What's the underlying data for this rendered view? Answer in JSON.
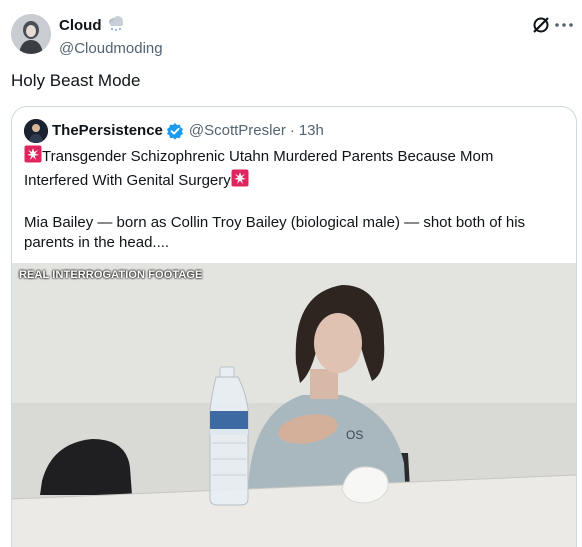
{
  "post": {
    "author_name": "Cloud",
    "author_handle": "@Cloudmoding",
    "text": "Holy Beast Mode"
  },
  "icons": {
    "author_badge": "snow-cloud-icon",
    "grok": "grok-icon",
    "more": "more-dots-icon",
    "verified": "verified-badge-icon",
    "siren": "rotating-light-icon"
  },
  "quote": {
    "name": "ThePersistence",
    "handle": "@ScottPresler",
    "separator": "·",
    "time": "13h",
    "line1": "Transgender Schizophrenic Utahn Murdered Parents Because Mom",
    "line2": "Interfered With Genital Surgery",
    "line3": "Mia Bailey — born as Collin Troy Bailey (biological male) — shot both of his",
    "line4": "parents in the head....",
    "media_label": "REAL INTERROGATION FOOTAGE"
  },
  "colors": {
    "text": "#0f1419",
    "secondary": "#536471",
    "border": "#cfd9de",
    "verified": "#1d9bf0",
    "siren": "#e0245e"
  }
}
